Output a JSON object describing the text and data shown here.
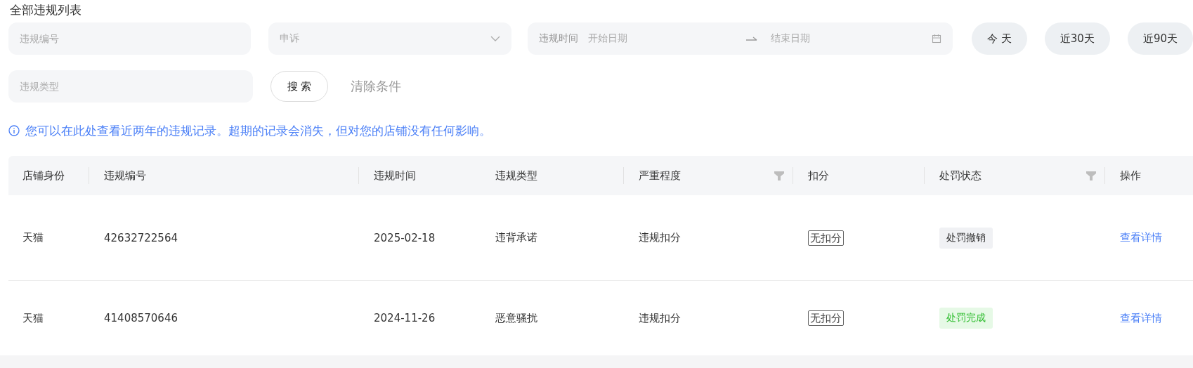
{
  "title": "全部违规列表",
  "filters": {
    "violation_no": {
      "placeholder": "违规编号"
    },
    "appeal": {
      "placeholder": "申诉"
    },
    "date_range": {
      "label": "违规时间",
      "start_placeholder": "开始日期",
      "end_placeholder": "结束日期"
    },
    "quick_ranges": [
      "今 天",
      "近30天",
      "近90天"
    ],
    "violation_type": {
      "placeholder": "违规类型"
    },
    "search_button": "搜 索",
    "clear_link": "清除条件"
  },
  "notice": "您可以在此处查看近两年的违规记录。超期的记录会消失，但对您的店铺没有任何影响。",
  "table": {
    "columns": [
      {
        "label": "店铺身份",
        "filter": false
      },
      {
        "label": "违规编号",
        "filter": false
      },
      {
        "label": "违规时间",
        "filter": false
      },
      {
        "label": "违规类型",
        "filter": false
      },
      {
        "label": "严重程度",
        "filter": true
      },
      {
        "label": "扣分",
        "filter": false
      },
      {
        "label": "处罚状态",
        "filter": true
      },
      {
        "label": "操作",
        "filter": false
      }
    ],
    "rows": [
      {
        "shop": "天猫",
        "violation_no": "42632722564",
        "time": "2025-02-18",
        "type": "违背承诺",
        "severity": "违规扣分",
        "points": "无扣分",
        "status": {
          "text": "处罚撤销",
          "kind": "revoked"
        },
        "action": "查看详情"
      },
      {
        "shop": "天猫",
        "violation_no": "41408570646",
        "time": "2024-11-26",
        "type": "恶意骚扰",
        "severity": "违规扣分",
        "points": "无扣分",
        "status": {
          "text": "处罚完成",
          "kind": "done"
        },
        "action": "查看详情"
      }
    ]
  }
}
